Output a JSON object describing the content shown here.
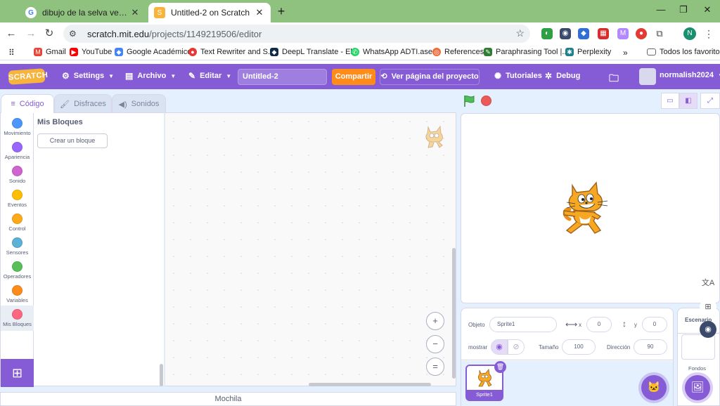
{
  "browser": {
    "tabs": [
      {
        "title": "dibujo de la selva venezolana p",
        "favicon": "google-icon"
      },
      {
        "title": "Untitled-2 on Scratch",
        "favicon": "scratch-icon"
      }
    ],
    "url_host": "scratch.mit.edu",
    "url_path": "/projects/1149219506/editor",
    "profile_initial": "N"
  },
  "bookmarks": [
    {
      "label": "Gmail",
      "icon": "gmail-icon",
      "color": "#ea4335"
    },
    {
      "label": "YouTube",
      "icon": "youtube-icon",
      "color": "#ff0000"
    },
    {
      "label": "Google Académico",
      "icon": "scholar-icon",
      "color": "#4285f4"
    },
    {
      "label": "Text Rewriter and S...",
      "icon": "rewriter-icon",
      "color": "#e53935"
    },
    {
      "label": "DeepL Translate - El...",
      "icon": "deepl-icon",
      "color": "#0f2b46"
    },
    {
      "label": "WhatsApp ADTI.ase...",
      "icon": "whatsapp-icon",
      "color": "#25d366"
    },
    {
      "label": "References",
      "icon": "references-icon",
      "color": "#f06a35"
    },
    {
      "label": "Paraphrasing Tool |...",
      "icon": "paraphrase-icon",
      "color": "#2e7d32"
    },
    {
      "label": "Perplexity",
      "icon": "perplexity-icon",
      "color": "#20808d"
    }
  ],
  "bookmarks_more": "»",
  "bookmarks_all": "Todos los favoritos",
  "menu": {
    "logo": "SCRATCH",
    "settings": "Settings",
    "file": "Archivo",
    "edit": "Editar",
    "project_name": "Untitled-2",
    "share": "Compartir",
    "see_project": "Ver página del proyecto",
    "tutorials": "Tutoriales",
    "debug": "Debug",
    "username": "normalish2024"
  },
  "editor_tabs": [
    {
      "label": "Código",
      "icon": "code-icon"
    },
    {
      "label": "Disfraces",
      "icon": "brush-icon"
    },
    {
      "label": "Sonidos",
      "icon": "speaker-icon"
    }
  ],
  "categories": [
    {
      "label": "Movimiento",
      "color": "#4c97ff"
    },
    {
      "label": "Apariencia",
      "color": "#9966ff"
    },
    {
      "label": "Sonido",
      "color": "#cf63cf"
    },
    {
      "label": "Eventos",
      "color": "#ffbf00"
    },
    {
      "label": "Control",
      "color": "#ffab19"
    },
    {
      "label": "Sensores",
      "color": "#5cb1d6"
    },
    {
      "label": "Operadores",
      "color": "#59c059"
    },
    {
      "label": "Variables",
      "color": "#ff8c1a"
    },
    {
      "label": "Mis Bloques",
      "color": "#ff6680"
    }
  ],
  "palette": {
    "title": "Mis Bloques",
    "make_block": "Crear un bloque"
  },
  "zoom": {
    "in": "+",
    "out": "−",
    "reset": "="
  },
  "backpack": "Mochila",
  "sprite_info": {
    "sprite_label": "Objeto",
    "sprite_name": "Sprite1",
    "x_label": "x",
    "x_value": "0",
    "y_label": "y",
    "y_value": "0",
    "show_label": "mostrar",
    "size_label": "Tamaño",
    "size_value": "100",
    "direction_label": "Dirección",
    "direction_value": "90"
  },
  "sprites": [
    {
      "name": "Sprite1"
    }
  ],
  "stage_pane": {
    "title": "Escenario",
    "backdrops": "Fondos"
  },
  "colors": {
    "accent": "#855cd6",
    "share": "#ff8c1a",
    "flag": "#4cbf56",
    "stop": "#ec5959"
  }
}
